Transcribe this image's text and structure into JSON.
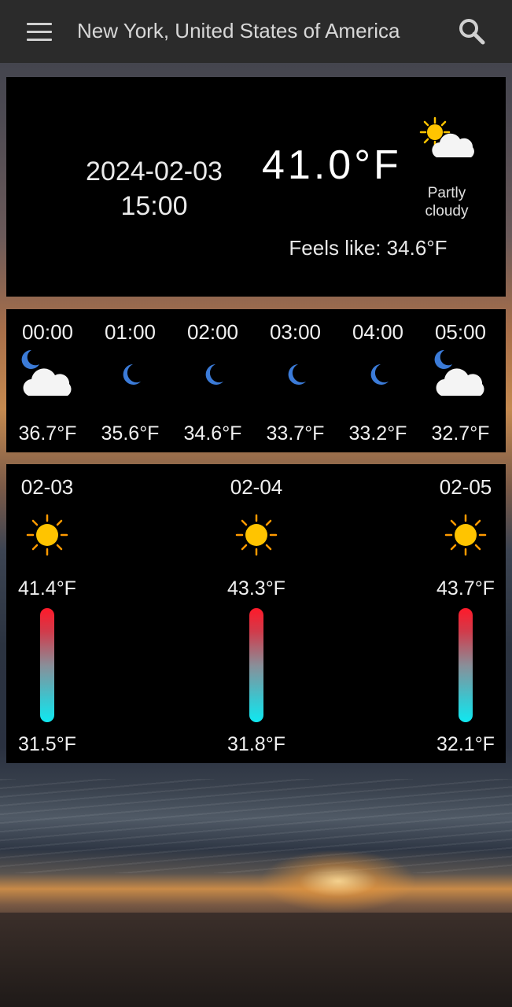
{
  "header": {
    "title": "New York, United States of America",
    "menu_icon": "hamburger-menu-icon",
    "search_icon": "search-icon"
  },
  "current": {
    "date": "2024-02-03",
    "time": "15:00",
    "temperature": "41.0°F",
    "condition": "Partly cloudy",
    "condition_icon": "partly-cloudy-day-icon",
    "feels_like": "Feels like: 34.6°F"
  },
  "hourly": [
    {
      "time": "00:00",
      "temp": "36.7°F",
      "icon": "partly-cloudy-night-icon"
    },
    {
      "time": "01:00",
      "temp": "35.6°F",
      "icon": "moon-icon"
    },
    {
      "time": "02:00",
      "temp": "34.6°F",
      "icon": "moon-icon"
    },
    {
      "time": "03:00",
      "temp": "33.7°F",
      "icon": "moon-icon"
    },
    {
      "time": "04:00",
      "temp": "33.2°F",
      "icon": "moon-icon"
    },
    {
      "time": "05:00",
      "temp": "32.7°F",
      "icon": "partly-cloudy-night-icon"
    }
  ],
  "daily": [
    {
      "date": "02-03",
      "high": "41.4°F",
      "low": "31.5°F",
      "icon": "sun-icon"
    },
    {
      "date": "02-04",
      "high": "43.3°F",
      "low": "31.8°F",
      "icon": "sun-icon"
    },
    {
      "date": "02-05",
      "high": "43.7°F",
      "low": "32.1°F",
      "icon": "sun-icon"
    }
  ],
  "colors": {
    "toolbar": "#2b2b2b",
    "panel": "#000000",
    "bar_top": "#ff1a2a",
    "bar_bottom": "#10e8f0",
    "sun": "#ffc400",
    "moon": "#3b7bd8"
  }
}
